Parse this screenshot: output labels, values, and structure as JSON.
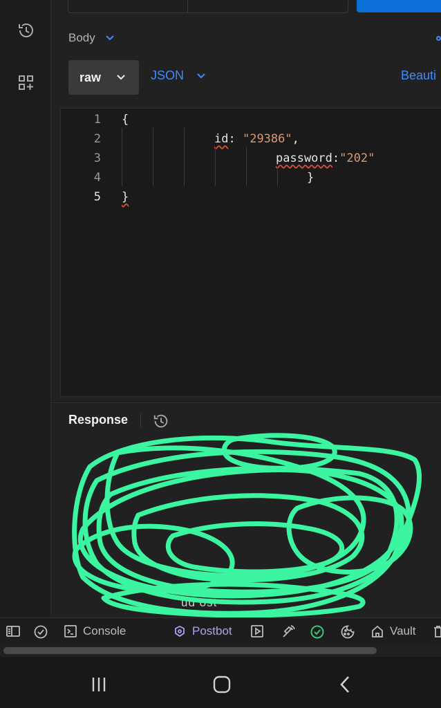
{
  "body_section": {
    "label": "Body",
    "mode_label": "raw",
    "format_label": "JSON",
    "beautify_label": "Beauti"
  },
  "editor": {
    "line_numbers": [
      "1",
      "2",
      "3",
      "4",
      "5"
    ],
    "open_brace": "{",
    "id_key": "id",
    "id_value": "\"29386\"",
    "password_key": "password",
    "password_value": "\"202\"",
    "inner_close": "}",
    "close_brace": "}"
  },
  "response": {
    "title": "Response",
    "obscured_text": "ud        ost"
  },
  "statusbar": {
    "console_label": "Console",
    "postbot_label": "Postbot",
    "vault_label": "Vault"
  },
  "colors": {
    "accent": "#3d8bfd",
    "send": "#0b6fd9",
    "redaction": "#3cf5a0",
    "postbot": "#b59df5"
  },
  "icons": [
    "history-icon",
    "add-collection-icon",
    "chevron-down-icon",
    "sidebar-toggle-icon",
    "check-circle-icon",
    "console-icon",
    "postbot-icon",
    "runner-icon",
    "capture-icon",
    "sync-check-icon",
    "cookie-icon",
    "vault-icon",
    "trash-icon",
    "recent-apps-icon",
    "home-icon",
    "back-icon"
  ]
}
